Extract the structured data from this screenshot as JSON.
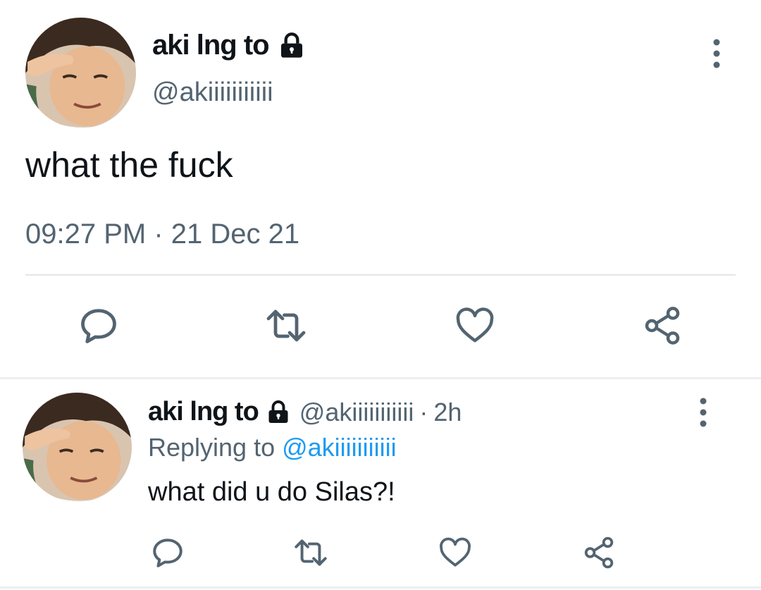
{
  "main_tweet": {
    "display_name": "aki lng to",
    "handle": "@akiiiiiiiiiii",
    "text": "what the fuck",
    "timestamp": "09:27 PM · 21 Dec 21",
    "icons": {
      "lock": "lock-icon",
      "more": "more-vertical-icon",
      "reply": "reply-icon",
      "retweet": "retweet-icon",
      "like": "heart-icon",
      "share": "share-icon"
    }
  },
  "reply_tweet": {
    "display_name": "aki lng to",
    "handle": "@akiiiiiiiiiii",
    "separator": "·",
    "time_ago": "2h",
    "replying_to_prefix": "Replying to ",
    "replying_to_handle": "@akiiiiiiiiiii",
    "text": "what did u do Silas?!"
  },
  "colors": {
    "text_primary": "#0f1419",
    "text_secondary": "#536471",
    "mention": "#1d9bf0",
    "icon": "#536471",
    "divider": "#e3e6e8"
  }
}
